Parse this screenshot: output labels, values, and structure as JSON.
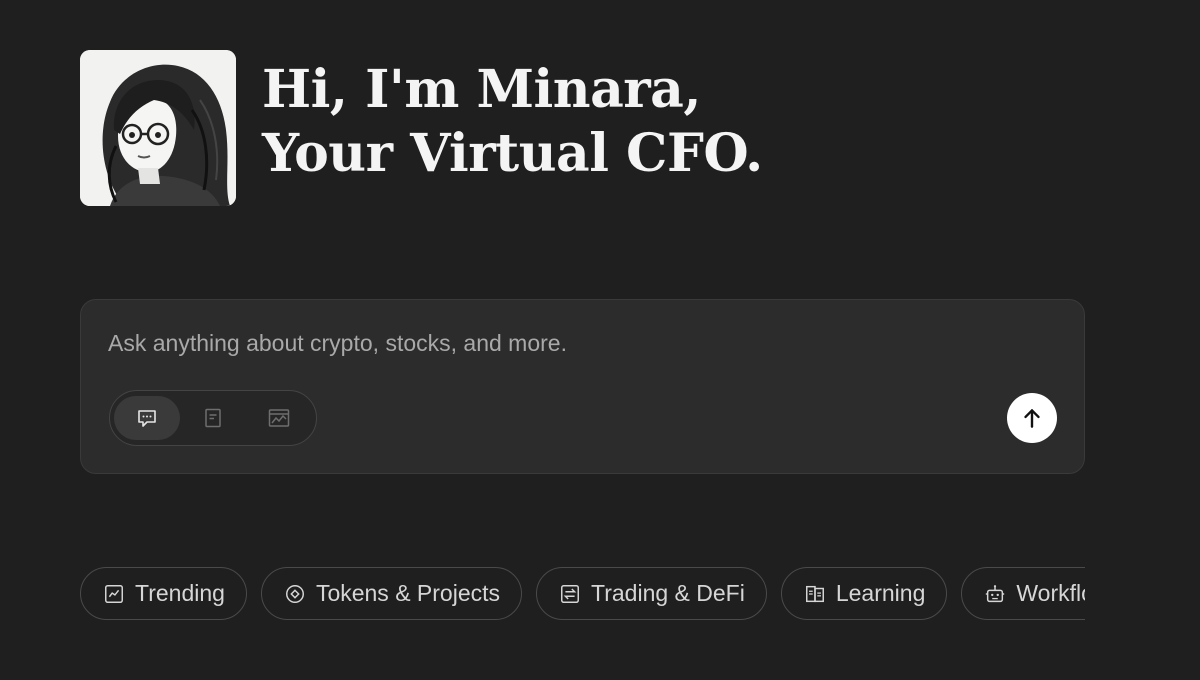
{
  "hero": {
    "line1": "Hi, I'm Minara,",
    "line2": "Your Virtual CFO."
  },
  "composer": {
    "placeholder": "Ask anything about crypto, stocks, and more.",
    "modes": [
      {
        "icon": "chat-icon",
        "active": true
      },
      {
        "icon": "document-icon",
        "active": false
      },
      {
        "icon": "chart-window-icon",
        "active": false
      }
    ],
    "send_icon": "arrow-up-icon"
  },
  "chips": [
    {
      "label": "Trending",
      "icon": "trend-chart-icon"
    },
    {
      "label": "Tokens & Projects",
      "icon": "token-icon"
    },
    {
      "label": "Trading & DeFi",
      "icon": "swap-icon"
    },
    {
      "label": "Learning",
      "icon": "book-icon"
    },
    {
      "label": "Workflows",
      "icon": "robot-icon"
    }
  ],
  "colors": {
    "background": "#1f1f1f",
    "panel": "#2c2c2c",
    "text": "#f4f4f4",
    "muted": "#a9a9a9"
  }
}
